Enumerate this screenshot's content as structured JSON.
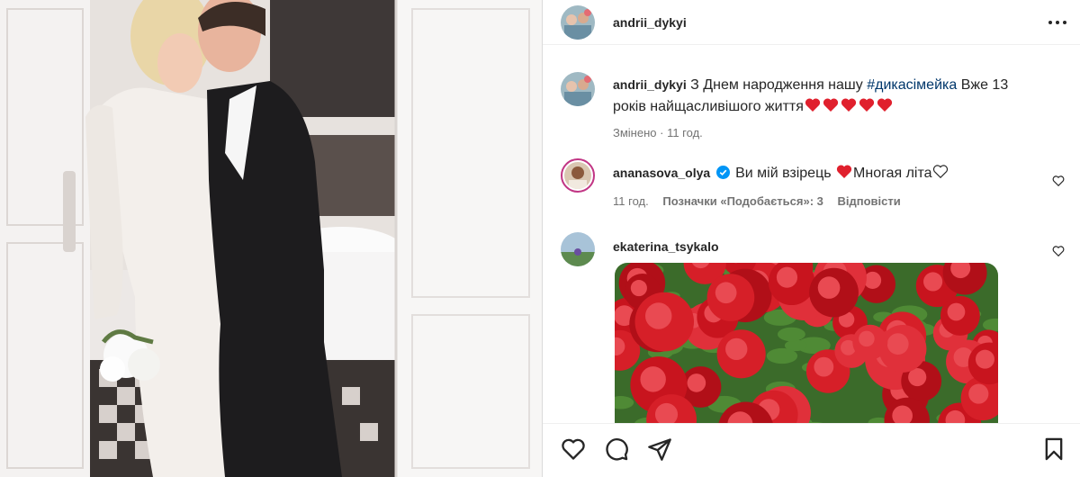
{
  "post": {
    "author": "andrii_dykyi",
    "caption_author": "andrii_dykyi",
    "caption_text_1": "З Днем народження нашу ",
    "caption_hashtag": "#дикасімейка",
    "caption_text_2": " Вже 13 років найщасливішого життя",
    "caption_hearts": 5,
    "edited_label": "Змінено",
    "edited_time": "11 год."
  },
  "comments": [
    {
      "user": "ananasova_olya",
      "verified": true,
      "text_1": "Ви мій взірець ",
      "text_2": "Многая літа",
      "time": "11 год.",
      "likes_label": "Позначки «Подобається»: 3",
      "reply_label": "Відповісти"
    },
    {
      "user": "ekaterina_tsykalo",
      "image": "red-roses"
    }
  ],
  "icons": {
    "more": "more-dots-icon",
    "like": "heart-outline-icon",
    "comment": "comment-bubble-icon",
    "share": "paper-plane-icon",
    "save": "bookmark-icon"
  },
  "colors": {
    "hashtag": "#00376b",
    "verified": "#0095f6",
    "heart_red": "#ed4956",
    "meta": "#737373"
  }
}
